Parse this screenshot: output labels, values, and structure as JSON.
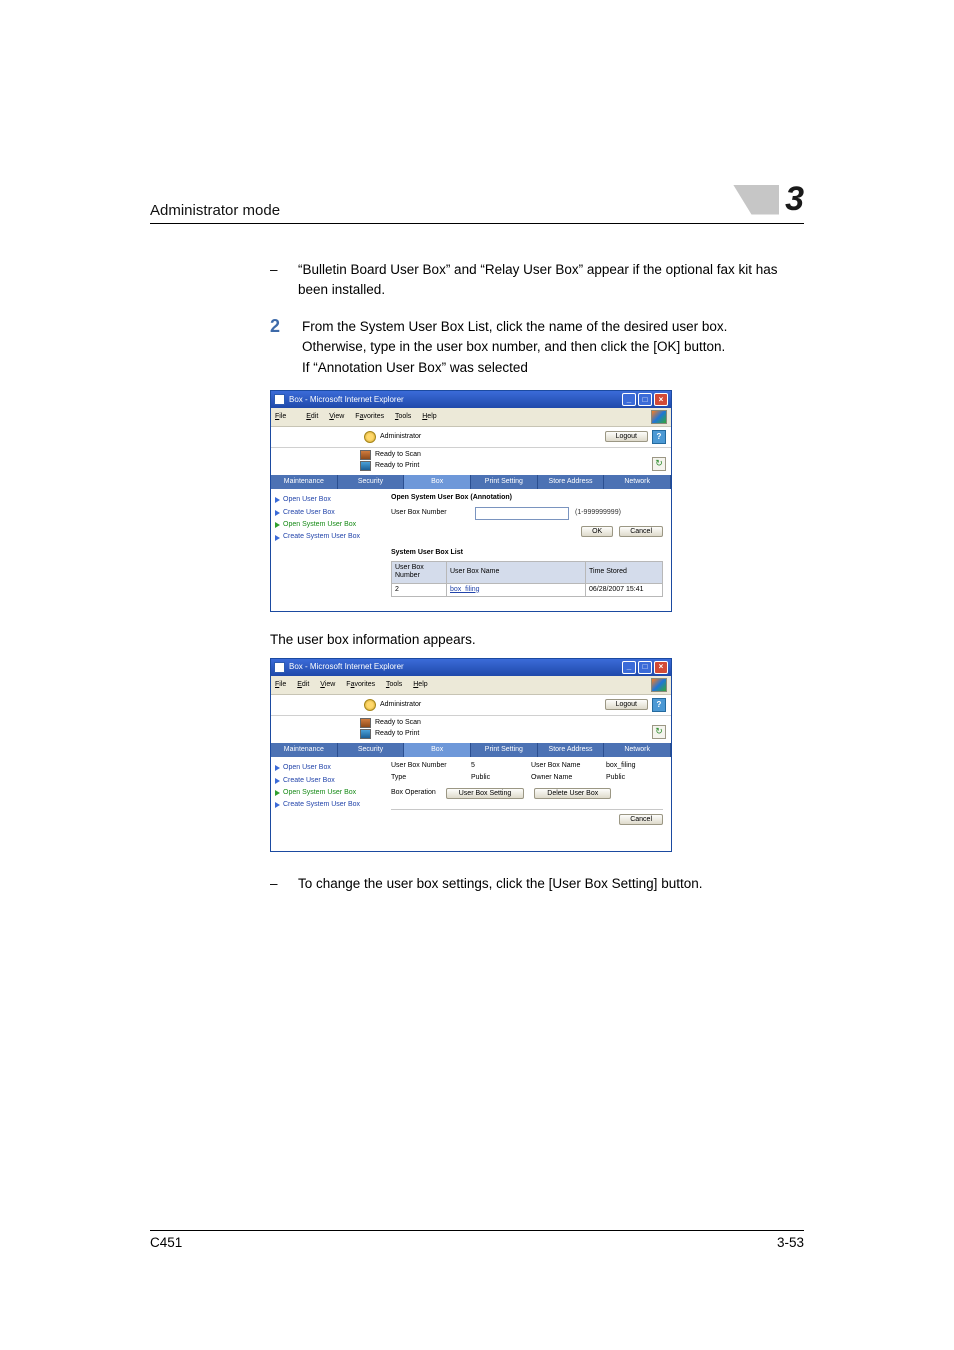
{
  "header": {
    "running_title": "Administrator mode",
    "chapter_number": "3"
  },
  "body": {
    "bullet1": "“Bulletin Board User Box” and “Relay User Box” appear if the optional fax kit has been installed.",
    "step2_number": "2",
    "step2_line1": "From the System User Box List, click the name of the desired user box. Otherwise, type in the user box number, and then click the [OK] button.",
    "step2_line2": "If “Annotation User Box” was selected",
    "after_shot1": "The user box information appears.",
    "bullet2": "To change the user box settings, click the [User Box Setting] button."
  },
  "ie": {
    "title": "Box - Microsoft Internet Explorer",
    "menus": {
      "file": "File",
      "edit": "Edit",
      "view": "View",
      "favorites": "Favorites",
      "tools": "Tools",
      "help": "Help"
    },
    "admin_label": "Administrator",
    "logout": "Logout",
    "help_glyph": "?",
    "refresh_glyph": "↻",
    "status_scan": "Ready to Scan",
    "status_print": "Ready to Print",
    "tabs": {
      "maintenance": "Maintenance",
      "security": "Security",
      "box": "Box",
      "print": "Print Setting",
      "store": "Store Address",
      "network": "Network"
    },
    "sidebar": {
      "open_user": "Open User Box",
      "create_user": "Create User Box",
      "open_system": "Open System User Box",
      "create_system": "Create System User Box"
    }
  },
  "shot1": {
    "section_title": "Open System User Box (Annotation)",
    "field_label": "User Box Number",
    "hint": "(1-999999999)",
    "ok": "OK",
    "cancel": "Cancel",
    "list_title": "System User Box List",
    "th_num": "User Box Number",
    "th_name": "User Box Name",
    "th_time": "Time Stored",
    "row_num": "2",
    "row_name": "box_filing",
    "row_time": "06/28/2007 15:41"
  },
  "shot2": {
    "field_num_label": "User Box Number",
    "field_num_value": "5",
    "field_name_label": "User Box Name",
    "field_name_value": "box_filing",
    "field_type_label": "Type",
    "field_type_value": "Public",
    "field_owner_label": "Owner Name",
    "field_owner_value": "Public",
    "box_operation": "Box Operation",
    "btn_setting": "User Box Setting",
    "btn_delete": "Delete User Box",
    "cancel": "Cancel"
  },
  "footer": {
    "model": "C451",
    "page": "3-53"
  }
}
